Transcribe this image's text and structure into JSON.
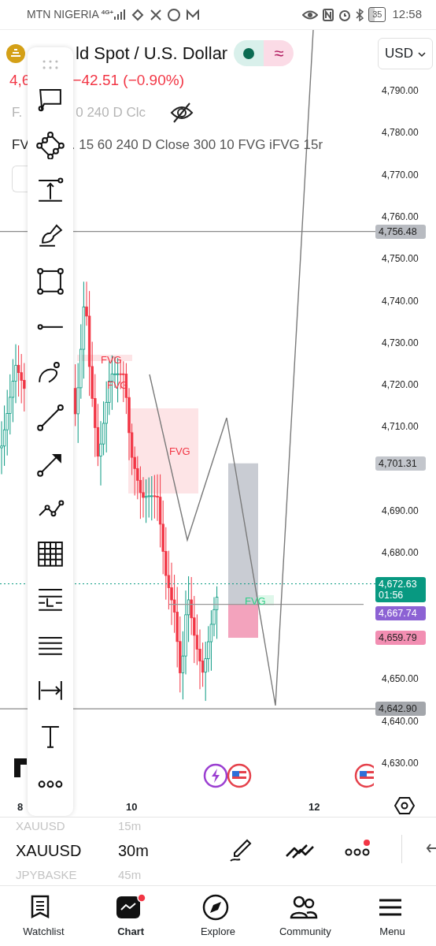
{
  "status_bar": {
    "carrier": "MTN NIGERIA",
    "network": "4G+",
    "battery": "35",
    "time": "12:58"
  },
  "symbol": {
    "title": "ld Spot / U.S. Dollar",
    "price": "4,6",
    "change": "−42.51 (−0.90%)",
    "badge_symbol": "≈",
    "currency": "USD"
  },
  "indicators": [
    {
      "name": "F.",
      "settings": "0 240 D Clc",
      "hidden": true
    },
    {
      "name": "FV",
      "settings": ". 15 60 240 D Close 300 10 FVG iFVG 15r",
      "hidden": false
    }
  ],
  "price_axis": {
    "ticks": [
      "4,790.00",
      "4,780.00",
      "4,770.00",
      "4,760.00",
      "4,750.00",
      "4,740.00",
      "4,730.00",
      "4,720.00",
      "4,710.00",
      "4,690.00",
      "4,680.00",
      "4,650.00",
      "4,640.00",
      "4,630.00"
    ]
  },
  "price_tags": [
    {
      "label": "4,756.48",
      "color": "#b8bbc1"
    },
    {
      "label": "4,701.31",
      "color": "#c3c6cc"
    },
    {
      "label": "4,672.63",
      "countdown": "01:56",
      "color": "#089981"
    },
    {
      "label": "4,667.74",
      "color": "#8c62d4"
    },
    {
      "label": "4,659.79",
      "color": "#f28eb2"
    },
    {
      "label": "4,642.90",
      "color": "#a3a6ab"
    }
  ],
  "zone_labels": [
    {
      "text": "FVG",
      "color": "#f23645"
    },
    {
      "text": "FVG",
      "color": "#f23645"
    },
    {
      "text": "FVG",
      "color": "#f23645"
    },
    {
      "text": "FVG",
      "color": "#2fcf86"
    }
  ],
  "time_axis": [
    "8",
    "10",
    "12"
  ],
  "symbol_picker": [
    {
      "symbol": "XAUUSD",
      "interval": "15m",
      "selected": false
    },
    {
      "symbol": "XAUUSD",
      "interval": "30m",
      "selected": true
    },
    {
      "symbol": "JPYBASKE",
      "interval": "45m",
      "selected": false
    }
  ],
  "nav": [
    {
      "label": "Watchlist",
      "selected": false
    },
    {
      "label": "Chart",
      "selected": true
    },
    {
      "label": "Explore",
      "selected": false
    },
    {
      "label": "Community",
      "selected": false
    },
    {
      "label": "Menu",
      "selected": false
    }
  ]
}
